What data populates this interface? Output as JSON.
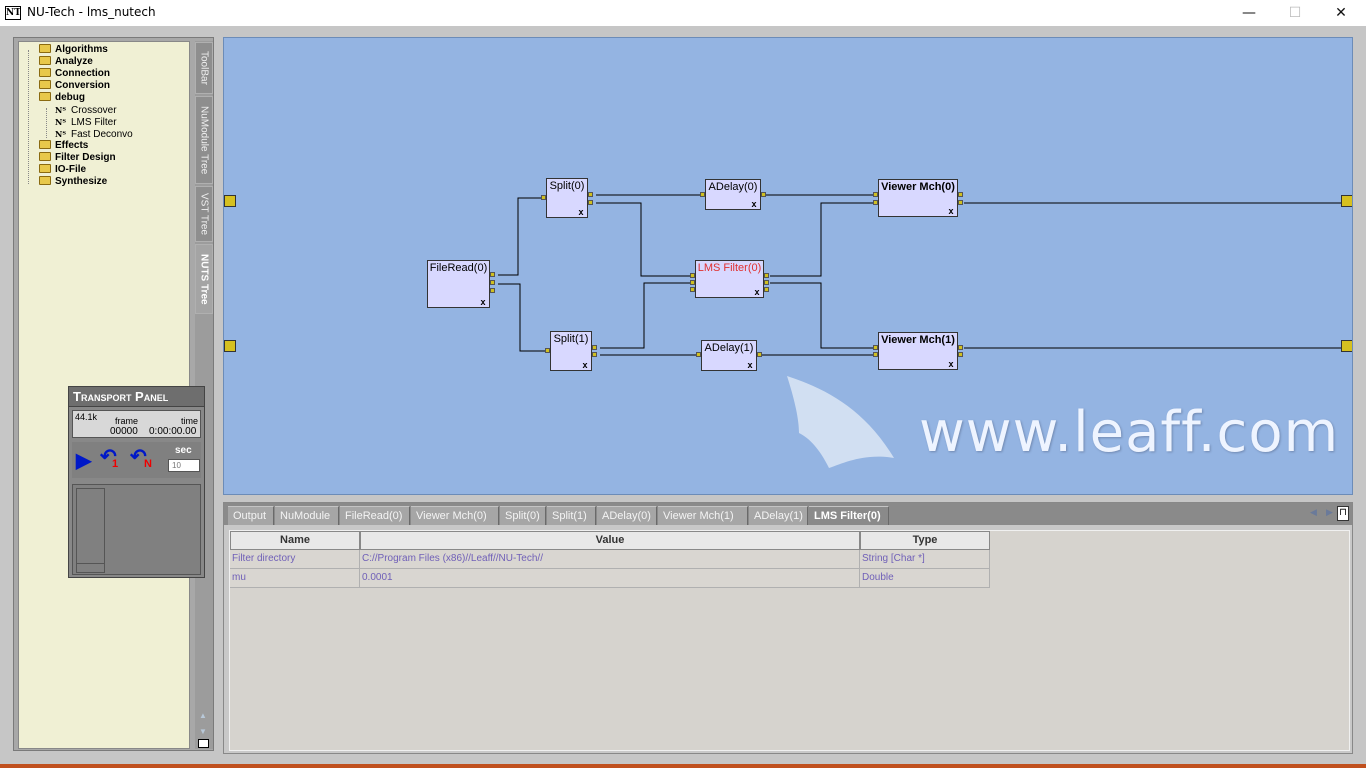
{
  "window": {
    "icon": "NT",
    "title": "NU-Tech  - lms_nutech",
    "minimize": "—",
    "maximize": "☐",
    "close": "✕"
  },
  "tree": {
    "folders": [
      "Algorithms",
      "Analyze",
      "Connection",
      "Conversion",
      "debug",
      "Effects",
      "Filter Design",
      "IO-File",
      "Synthesize"
    ],
    "debug_children": [
      "Crossover",
      "LMS Filter",
      "Fast Deconvo"
    ]
  },
  "side_tabs": [
    "ToolBar",
    "NuModule Tree",
    "VST Tree",
    "NUTS Tree"
  ],
  "transport": {
    "title": "Transport Panel",
    "rate": "44.1k",
    "frame_label": "frame",
    "time_label": "time",
    "frame_value": "00000",
    "time_value": "0:00:00.00",
    "play_icon": "play-icon",
    "step1_sub": "1",
    "stepN_sub": "N",
    "sec_label": "sec",
    "sec_value": "10"
  },
  "modules": [
    {
      "id": "fileread0",
      "label": "FileRead(0)",
      "style": "normal"
    },
    {
      "id": "split0",
      "label": "Split(0)",
      "style": "normal"
    },
    {
      "id": "split1",
      "label": "Split(1)",
      "style": "normal"
    },
    {
      "id": "adelay0",
      "label": "ADelay(0)",
      "style": "normal"
    },
    {
      "id": "adelay1",
      "label": "ADelay(1)",
      "style": "normal"
    },
    {
      "id": "lms0",
      "label": "LMS Filter(0)",
      "style": "red"
    },
    {
      "id": "viewer0",
      "label": "Viewer Mch(0)",
      "style": "bold"
    },
    {
      "id": "viewer1",
      "label": "Viewer Mch(1)",
      "style": "bold"
    }
  ],
  "module_close": "x",
  "watermark": "www.leaff.com",
  "tabs": [
    "Output",
    "NuModule",
    "FileRead(0)",
    "Viewer Mch(0)",
    "Split(0)",
    "Split(1)",
    "ADelay(0)",
    "Viewer Mch(1)",
    "ADelay(1)",
    "LMS Filter(0)"
  ],
  "active_tab": "LMS Filter(0)",
  "properties": {
    "headers": [
      "Name",
      "Value",
      "Type"
    ],
    "rows": [
      {
        "name": "Filter directory",
        "value": "C://Program Files (x86)//Leaff//NU-Tech//",
        "type": "String [Char *]"
      },
      {
        "name": "mu",
        "value": "0.0001",
        "type": "Double"
      }
    ]
  }
}
